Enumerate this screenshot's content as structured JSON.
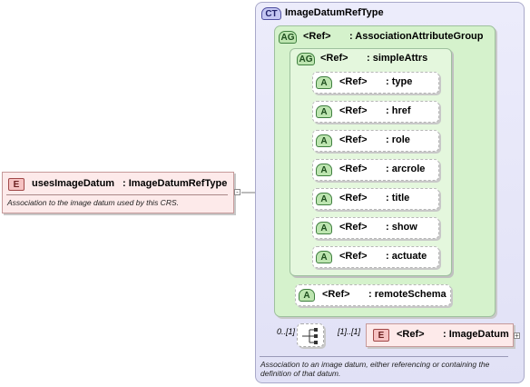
{
  "complex_type": {
    "badge": "CT",
    "name": "ImageDatumRefType",
    "annotation": "Association to an image datum, either referencing or containing the definition of that datum."
  },
  "attribute_group_outer": {
    "badge": "AG",
    "ref": "<Ref>",
    "name": ": AssociationAttributeGroup"
  },
  "attribute_group_inner": {
    "badge": "AG",
    "ref": "<Ref>",
    "name": ": simpleAttrs"
  },
  "attributes": [
    {
      "badge": "A",
      "ref": "<Ref>",
      "name": ": type"
    },
    {
      "badge": "A",
      "ref": "<Ref>",
      "name": ": href"
    },
    {
      "badge": "A",
      "ref": "<Ref>",
      "name": ": role"
    },
    {
      "badge": "A",
      "ref": "<Ref>",
      "name": ": arcrole"
    },
    {
      "badge": "A",
      "ref": "<Ref>",
      "name": ": title"
    },
    {
      "badge": "A",
      "ref": "<Ref>",
      "name": ": show"
    },
    {
      "badge": "A",
      "ref": "<Ref>",
      "name": ": actuate"
    }
  ],
  "remote_schema": {
    "badge": "A",
    "ref": "<Ref>",
    "name": ": remoteSchema"
  },
  "root_element": {
    "badge": "E",
    "name": "usesImageDatum",
    "type": ": ImageDatumRefType",
    "annotation": "Association to the image datum used by this CRS."
  },
  "sequence": {
    "min_occurs": "0..[1]",
    "max_occurs": "[1]..[1]"
  },
  "child_element": {
    "badge": "E",
    "ref": "<Ref>",
    "name": ": ImageDatum"
  }
}
